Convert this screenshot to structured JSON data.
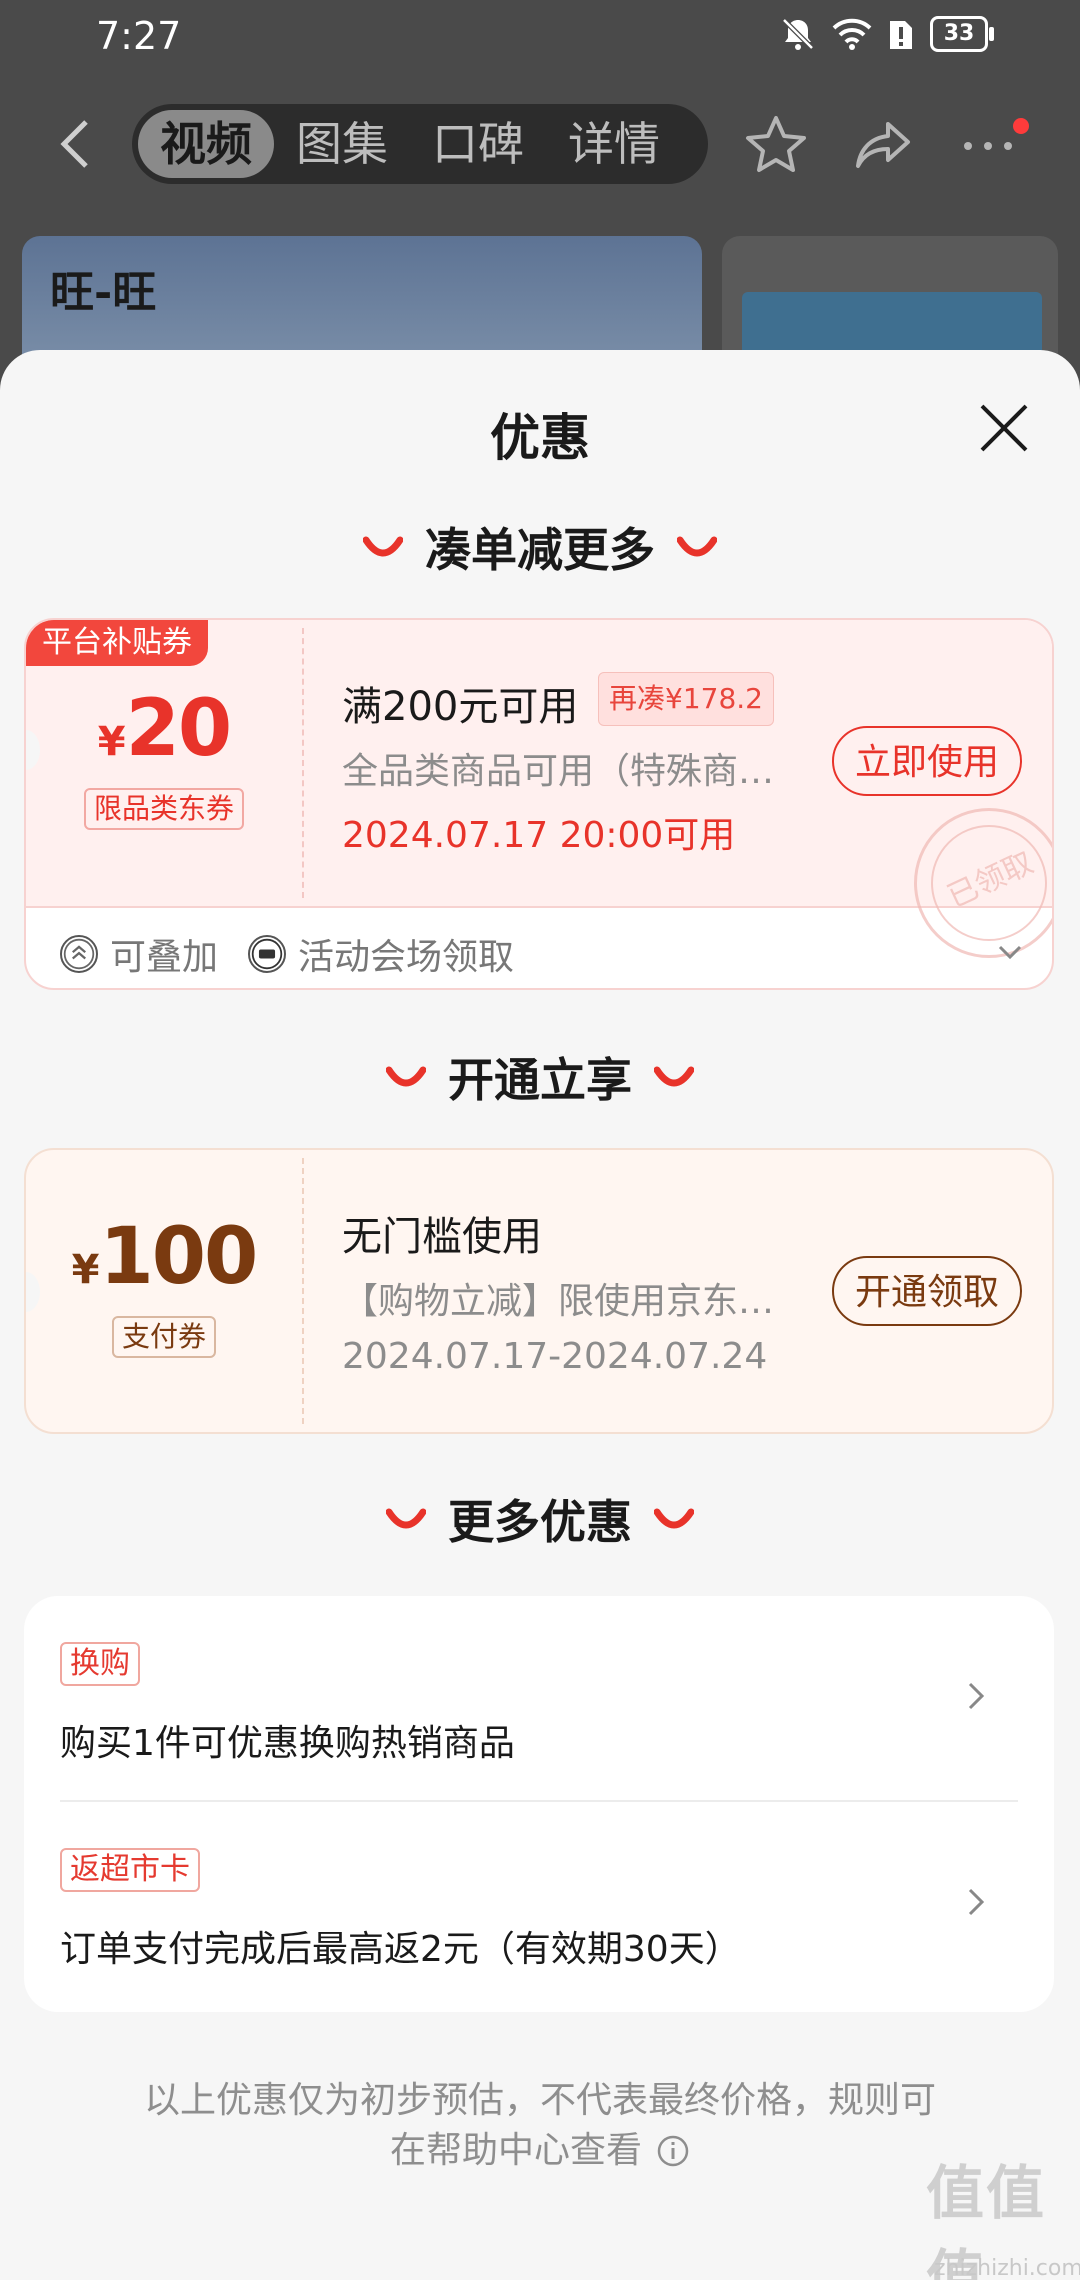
{
  "status_bar": {
    "time": "7:27",
    "battery": "33"
  },
  "nav": {
    "tabs": [
      "视频",
      "图集",
      "口碑",
      "详情"
    ],
    "active_tab": "视频"
  },
  "hero": {
    "brand": "旺-旺"
  },
  "sheet": {
    "title": "优惠",
    "sections": {
      "bundle": "凑单减更多",
      "activate": "开通立享",
      "more": "更多优惠"
    }
  },
  "coupon1": {
    "ribbon": "平台补贴券",
    "currency": "¥",
    "amount": "20",
    "type": "限品类东券",
    "title": "满200元可用",
    "extra": "再凑¥178.2",
    "desc": "全品类商品可用（特殊商…",
    "date": "2024.07.17 20:00可用",
    "button": "立即使用",
    "stamp": "已领取",
    "footer": {
      "stack": "可叠加",
      "source": "活动会场领取"
    }
  },
  "coupon2": {
    "currency": "¥",
    "amount": "100",
    "type": "支付券",
    "title": "无门槛使用",
    "desc": "【购物立减】限使用京东…",
    "date": "2024.07.17-2024.07.24",
    "button": "开通领取"
  },
  "more_deals": [
    {
      "badge": "换购",
      "text": "购买1件可优惠换购热销商品"
    },
    {
      "badge": "返超市卡",
      "text": "订单支付完成后最高返2元（有效期30天）"
    }
  ],
  "footnote": {
    "line1": "以上优惠仅为初步预估，不代表最终价格，规则可",
    "line2": "在帮助中心查看"
  },
  "watermark": {
    "main": "值值值",
    "sub": "zhizhizhi.com"
  },
  "colors": {
    "accent_red": "#e8453c",
    "brown": "#7a3a10",
    "dim_overlay": "#4a4a4a"
  }
}
